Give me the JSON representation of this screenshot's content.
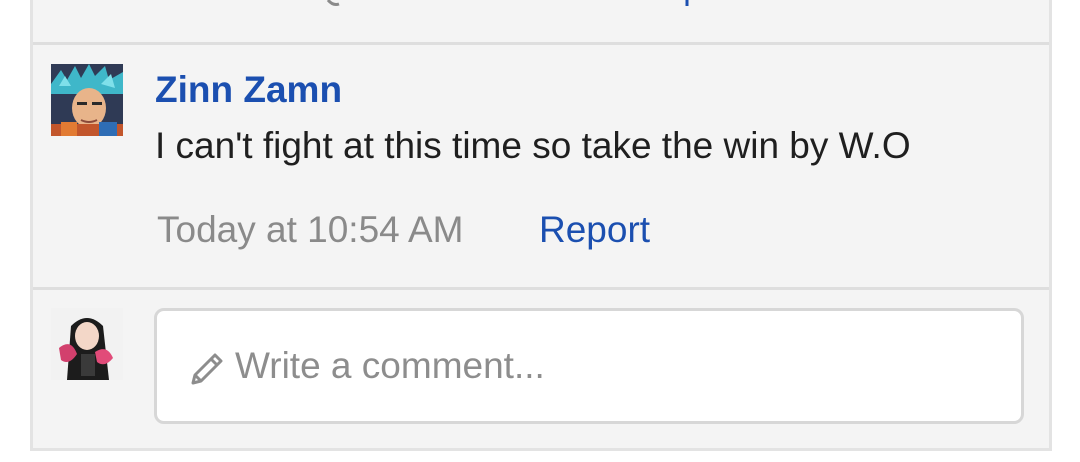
{
  "comment": {
    "author": "Zinn Zamn",
    "text": "I can't fight at this time so take the win by W.O",
    "timestamp": "Today at 10:54 AM",
    "report_label": "Report"
  },
  "composer": {
    "placeholder": "Write a comment..."
  },
  "colors": {
    "link": "#1b4fb0",
    "muted": "#8a8a8a",
    "panel_bg": "#f4f4f4"
  },
  "icons": {
    "composer": "pencil-icon"
  }
}
